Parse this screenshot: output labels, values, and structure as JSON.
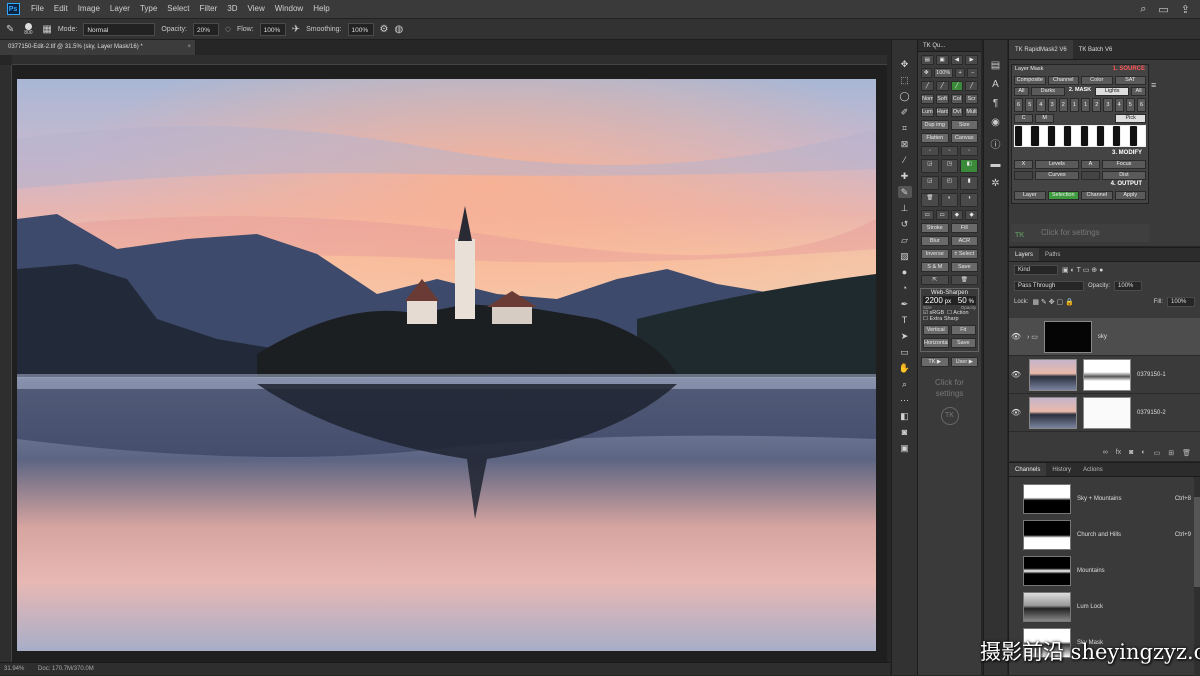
{
  "app": {
    "name": "Photoshop",
    "logo_text": "Ps"
  },
  "menu": [
    "File",
    "Edit",
    "Image",
    "Layer",
    "Type",
    "Select",
    "Filter",
    "3D",
    "View",
    "Window",
    "Help"
  ],
  "options": {
    "brush_size": "800",
    "mode_label": "Mode:",
    "mode_value": "Normal",
    "opacity_label": "Opacity:",
    "opacity_value": "20%",
    "flow_label": "Flow:",
    "flow_value": "100%",
    "smoothing_label": "Smoothing:",
    "smoothing_value": "100%"
  },
  "document": {
    "tab_title": "0377150-Edit-2.tif @ 31.5% (sky, Layer Mask/16) *",
    "close": "×"
  },
  "status": {
    "zoom": "31.94%",
    "doc_size": "Doc: 170.7M/370.0M"
  },
  "tk_panel": {
    "title": "TK Qu...",
    "rows": [
      [
        "Norm",
        "Soft",
        "Col",
        "Scr"
      ],
      [
        "Lum",
        "Hard",
        "Ovl",
        "Mult"
      ],
      [
        "Dup img",
        "Size"
      ],
      [
        "Flatten",
        "Canvas"
      ],
      [
        "Stroke",
        "Fill"
      ],
      [
        "Blur",
        "ACR"
      ],
      [
        "Inverse",
        "± Select"
      ],
      [
        "S & M",
        "Save"
      ]
    ],
    "zoom_button": "100%",
    "websharpen_title": "Web-Sharpen",
    "ws_size_value": "2200",
    "ws_size_unit": "px",
    "ws_opacity_value": "50",
    "ws_opacity_unit": "%",
    "ws_size_label": "Size",
    "ws_opacity_label": "Opacity",
    "ws_srgb": "sRGB",
    "ws_action": "Action",
    "ws_extra": "Extra Sharp",
    "ws_rows": [
      [
        "Vertical",
        "Fit"
      ],
      [
        "Horizontal",
        "Save"
      ]
    ],
    "bottom_buttons": [
      "TK ▶",
      "User ▶"
    ],
    "hint": "Click for settings",
    "logo": "TK"
  },
  "rapid_mask": {
    "tabs": [
      "TK RapidMask2 V6",
      "TK Batch V6"
    ],
    "header": "Layer Mask",
    "sections": {
      "source": "1. SOURCE",
      "mask": "2. MASK",
      "modify": "3. MODIFY",
      "output": "4. OUTPUT"
    },
    "source_buttons": [
      "Composite",
      "Channel",
      "Color",
      "SAT"
    ],
    "mask_buttons": [
      "All",
      "Darks",
      "Lights",
      "All"
    ],
    "numbers": [
      "6",
      "5",
      "4",
      "3",
      "2",
      "1",
      "1",
      "2",
      "3",
      "4",
      "5",
      "6"
    ],
    "mid_buttons": [
      "C",
      "M",
      "Pick"
    ],
    "modify_row1": [
      "X",
      "Levels",
      "A",
      "Focus"
    ],
    "modify_row2": [
      "Curves",
      "Dist"
    ],
    "output_buttons": [
      "Layer",
      "Selection",
      "Channel",
      "Apply"
    ],
    "hint": "Click for settings",
    "logo": "TK"
  },
  "layers": {
    "tabs": [
      "Layers",
      "Paths"
    ],
    "filter": "Kind",
    "blend": "Pass Through",
    "opacity_label": "Opacity:",
    "opacity_value": "100%",
    "lock_label": "Lock:",
    "fill_label": "Fill:",
    "fill_value": "100%",
    "items": [
      {
        "name": "sky"
      },
      {
        "name": "0379150-1"
      },
      {
        "name": "0379150-2"
      }
    ]
  },
  "channels": {
    "tabs": [
      "Channels",
      "History",
      "Actions"
    ],
    "items": [
      {
        "name": "Sky + Mountains",
        "key": "Ctrl+8"
      },
      {
        "name": "Church and Hills",
        "key": "Ctrl+9"
      },
      {
        "name": "Mountains",
        "key": ""
      },
      {
        "name": "Lum Lock",
        "key": ""
      },
      {
        "name": "Sky Mask",
        "key": ""
      }
    ]
  },
  "watermark": "摄影前沿 sheyingzyz.com",
  "colors": {
    "accent": "#31a8ff",
    "green": "#3f9a3f",
    "panel": "#3a3a3a"
  }
}
